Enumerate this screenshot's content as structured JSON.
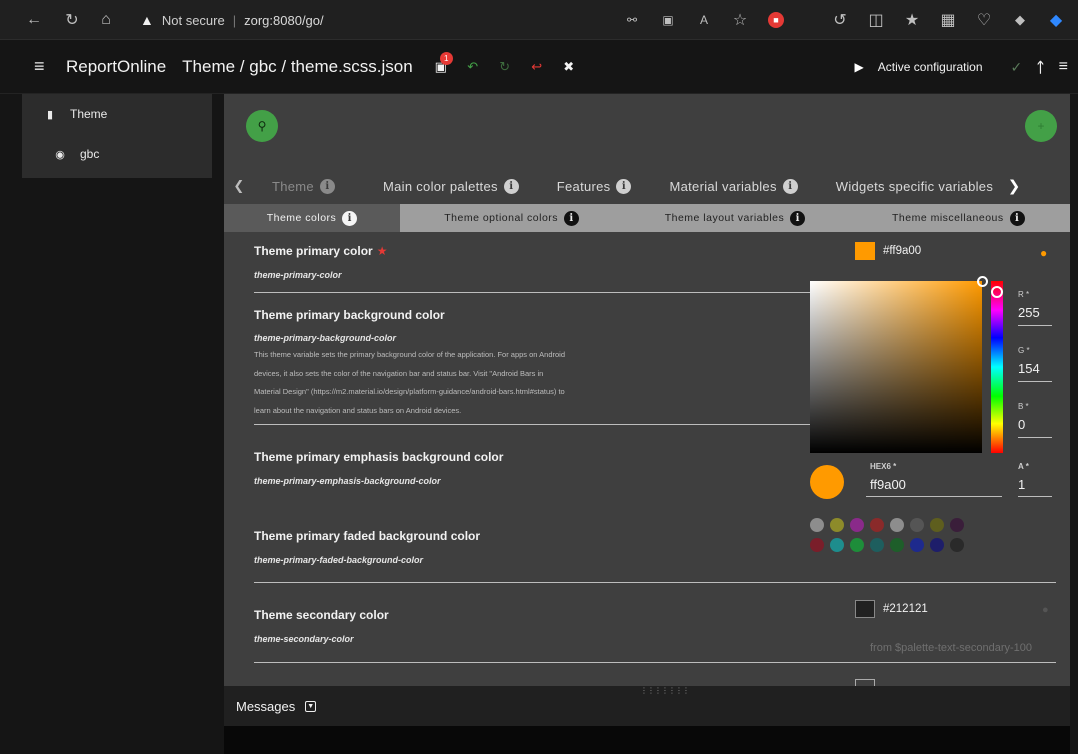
{
  "browser": {
    "security": "Not secure",
    "url": "zorg:8080/go/"
  },
  "header": {
    "brand": "ReportOnline",
    "path": "Theme / gbc / theme.scss.json",
    "save_badge": "1",
    "active_label": "Active configuration"
  },
  "sidebar": {
    "items": [
      {
        "label": "Theme",
        "icon": "file-icon"
      },
      {
        "label": "gbc",
        "icon": "eye-icon"
      }
    ]
  },
  "tabs": {
    "primary": [
      "Theme",
      "Main color palettes",
      "Features",
      "Material variables",
      "Widgets specific variables"
    ],
    "secondary": [
      "Theme colors",
      "Theme optional colors",
      "Theme layout variables",
      "Theme miscellaneous"
    ]
  },
  "rows": [
    {
      "label": "Theme primary color",
      "var": "theme-primary-color"
    },
    {
      "label": "Theme primary background color",
      "var": "theme-primary-background-color",
      "desc": [
        "This theme variable sets the primary background color of the application. For apps on Android",
        "devices, it also sets the color of the navigation bar and status bar. Visit \"Android Bars in",
        "Material Design\" (https://m2.material.io/design/platform-guidance/android-bars.html#status) to",
        "learn about the navigation and status bars on Android devices."
      ]
    },
    {
      "label": "Theme primary emphasis background color",
      "var": "theme-primary-emphasis-background-color"
    },
    {
      "label": "Theme primary faded background color",
      "var": "theme-primary-faded-background-color"
    },
    {
      "label": "Theme secondary color",
      "var": "theme-secondary-color"
    }
  ],
  "picker": {
    "swatch_hex": "#ff9a00",
    "r_label": "R *",
    "r": "255",
    "g_label": "G *",
    "g": "154",
    "b_label": "B *",
    "b": "0",
    "hex_label": "HEX6 *",
    "hex": "ff9a00",
    "a_label": "A *",
    "a": "1",
    "palette_row1": [
      "#8d8d8d",
      "#8d8b2a",
      "#8a2a8a",
      "#8a2a2a",
      "#8d8d8d",
      "#555",
      "#5e5e1e",
      "#3a1e3a"
    ],
    "palette_row2": [
      "#7a1e2a",
      "#1e8d8d",
      "#1e8d3a",
      "#1e5e5e",
      "#1e5e2a",
      "#1e2a8d",
      "#1e1e6a",
      "#2a2a2a"
    ]
  },
  "secondary": {
    "hex": "#212121",
    "hint": "from $palette-text-secondary-100"
  },
  "messages": {
    "label": "Messages"
  }
}
